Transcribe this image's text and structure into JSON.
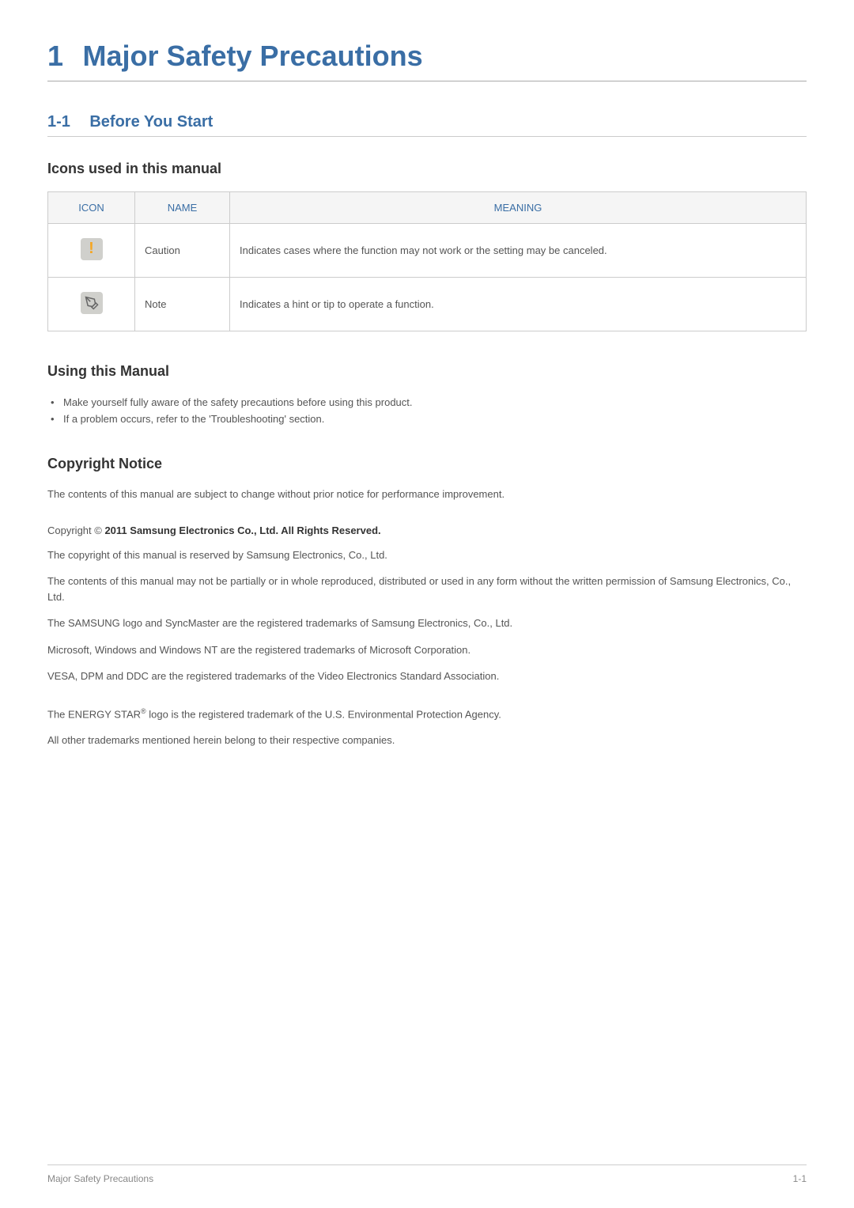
{
  "chapter": {
    "number": "1",
    "title": "Major Safety Precautions"
  },
  "section": {
    "number": "1-1",
    "title": "Before You Start"
  },
  "icons_section": {
    "heading": "Icons used in this manual",
    "table": {
      "headers": {
        "icon": "ICON",
        "name": "NAME",
        "meaning": "MEANING"
      },
      "rows": [
        {
          "icon_name": "caution-icon",
          "name": "Caution",
          "meaning": "Indicates cases where the function may not work or the setting may be canceled."
        },
        {
          "icon_name": "note-icon",
          "name": "Note",
          "meaning": "Indicates a hint or tip to operate a function."
        }
      ]
    }
  },
  "using_manual": {
    "heading": "Using this Manual",
    "items": [
      "Make yourself fully aware of the safety precautions before using this product.",
      "If a problem occurs, refer to the 'Troubleshooting' section."
    ]
  },
  "copyright": {
    "heading": "Copyright Notice",
    "intro": "The contents of this manual are subject to change without prior notice for performance improvement.",
    "copyright_prefix": "Copyright © ",
    "copyright_bold": "2011 Samsung Electronics Co., Ltd. All Rights Reserved.",
    "paragraphs": [
      "The copyright of this manual is reserved by Samsung Electronics, Co., Ltd.",
      "The contents of this manual may not be partially or in whole reproduced, distributed or used in any form without the written permission of Samsung Electronics, Co., Ltd.",
      "The SAMSUNG logo and SyncMaster are the registered trademarks of Samsung Electronics, Co., Ltd.",
      "Microsoft, Windows and Windows NT are the registered trademarks of Microsoft Corporation.",
      "VESA, DPM and DDC are the registered trademarks of the Video Electronics Standard Association."
    ],
    "energy_star_prefix": "The ENERGY STAR",
    "energy_star_super": "®",
    "energy_star_suffix": " logo is the registered trademark of the U.S. Environmental Protection Agency.",
    "trademarks_other": "All other trademarks mentioned herein belong to their respective companies."
  },
  "footer": {
    "left": "Major Safety Precautions",
    "right": "1-1"
  }
}
